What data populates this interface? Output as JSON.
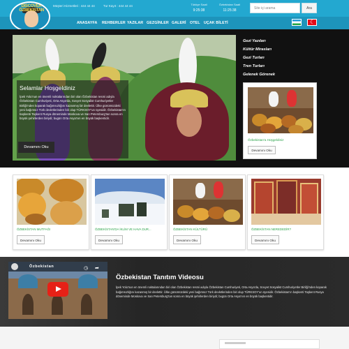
{
  "topbar": {
    "phone_label": "Müşteri Hizmetleri : 444 44 44",
    "call_label": "Tur Kayıt : 444 44 44",
    "clocks": [
      {
        "label": "Türkiye Saati",
        "time": "9:25:38"
      },
      {
        "label": "Özbekistan Saati",
        "time": "11:25:38"
      }
    ],
    "search_placeholder": "Site içi arama",
    "search_button": "Ara"
  },
  "logo": {
    "text": "DISCOVER ÖZBEKISTAN"
  },
  "nav": {
    "items": [
      "ANASAYFA",
      "REHBERLER",
      "YAZILAR",
      "GEZGİNLER",
      "GALERİ",
      "OTEL",
      "UÇAK BİLETİ"
    ]
  },
  "languages": {
    "uz": "Uzbekistan flag",
    "tr": "Turkey flag"
  },
  "hero": {
    "title": "Selamlar Hoşgeldiniz",
    "text": "İpek Yolu'nun en önemli noktalarından biri olan Özbekistan resmi adıyla Özbekistan Cumhuriyeti, Orta Asya'da, Sovyet Sosyalist Cumhuriyetler Birliği'nden koparak bağımsızlığını kazanmış bir devlettir. Ülke günümüzdeki yeni bağımsız Türk devletlerinden biri olup TÜRKSOY'un üyesidir. Özbekistan'ın başkenti Taşkent Rusya döneminde Moskova ve San Petersburg'tan sonra en büyük şehirlerden biriydi; bugün Orta Asya'nın en büyük başkentidir.",
    "button": "Devamını Oku"
  },
  "side_menu": {
    "links": [
      "Gezi Yazıları",
      "Kültür Mirasları",
      "Gezi Turları",
      "Tren Turları",
      "Gelenek Görenek"
    ],
    "card_caption": "Özbekistan'a Hoşgeldiniz",
    "card_button": "Devamını Oku"
  },
  "cards": [
    {
      "caption": "ÖZBEKİSTAN MUTFAĞI",
      "button": "Devamını Oku"
    },
    {
      "caption": "ÖZBEKİSTAN'DA İKLİM VE HAVA DUR...",
      "button": "Devamını Oku"
    },
    {
      "caption": "ÖZBEKİSTAN KÜLTÜRÜ",
      "button": "Devamını Oku"
    },
    {
      "caption": "ÖZBEKİSTAN NEREDEDİR?",
      "button": "Devamını Oku"
    }
  ],
  "video": {
    "thumb_title": "Özbekistan",
    "title": "Özbekistan Tanıtım Videosu",
    "text": "İpek Yolu'nun en önemli noktalarından biri olan Özbekistan resmi adıyla Özbekistan Cumhuriyeti, Orta Asya'da, Sovyet Sosyalist Cumhuriyetler Birliği'nden koparak bağımsızlığını kazanmış bir devlettir. Ülke günümüzdeki yeni bağımsız Türk devletlerinden biri olup TÜRKSOY'un üyesidir. Özbekistan'ın başkenti Taşkent Rusya döneminde Moskova ve San Petersburg'tan sonra en büyük şehirlerden biriydi; bugün Orta Asya'nın en büyük başkentidir."
  },
  "colors": {
    "topbar": "#23a8d0",
    "nav": "#1d94bb",
    "caption_green": "#2ba34a",
    "dark_band": "#2d2d2d"
  }
}
